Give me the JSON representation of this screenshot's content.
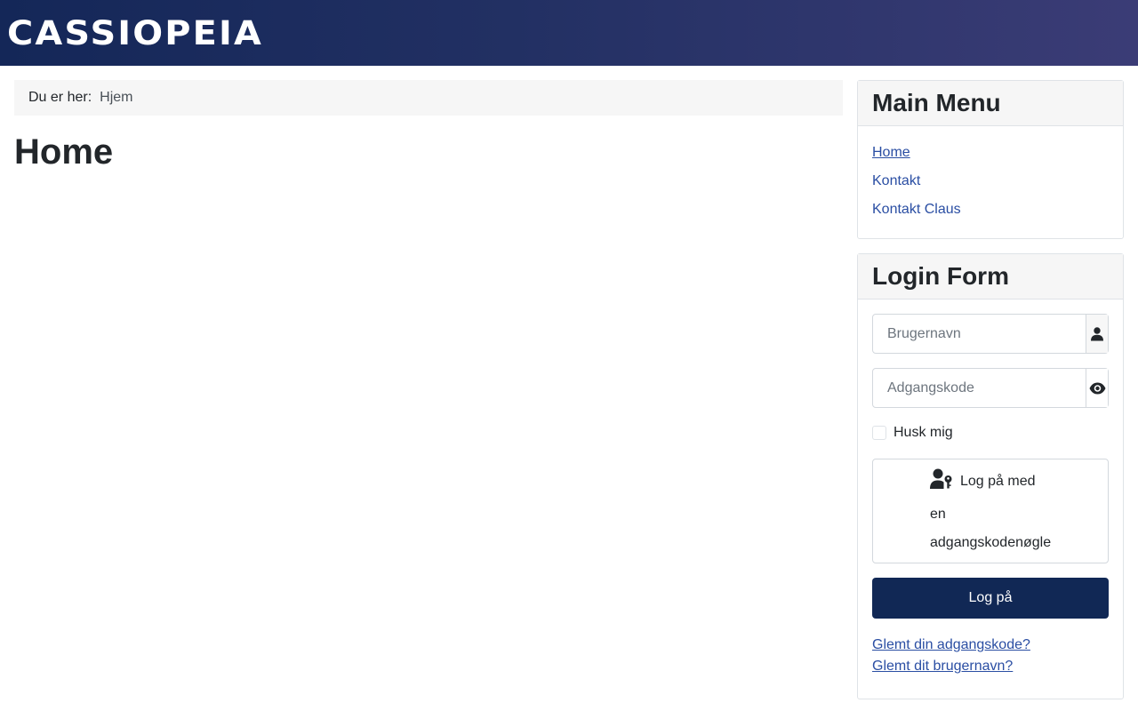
{
  "header": {
    "brand": "CASSIOPEIA",
    "colors": {
      "gradient_start": "#142758",
      "gradient_end": "#3b3c76"
    }
  },
  "breadcrumb": {
    "label": "Du er her:",
    "items": [
      "Hjem"
    ]
  },
  "page": {
    "title": "Home"
  },
  "main_menu": {
    "title": "Main Menu",
    "items": [
      {
        "label": "Home",
        "active": true
      },
      {
        "label": "Kontakt",
        "active": false
      },
      {
        "label": "Kontakt Claus",
        "active": false
      }
    ]
  },
  "login_form": {
    "title": "Login Form",
    "username": {
      "placeholder": "Brugernavn",
      "value": "",
      "icon": "user-icon"
    },
    "password": {
      "placeholder": "Adgangskode",
      "value": "",
      "icon": "eye-icon"
    },
    "remember_label": "Husk mig",
    "passkey_label": "Log på med en adgangskodenøgle",
    "passkey_icon": "user-key-icon",
    "submit_label": "Log på",
    "links": [
      "Glemt din adgangskode?",
      "Glemt dit brugernavn?"
    ],
    "colors": {
      "primary_button": "#112855",
      "link": "#2a4ea3"
    }
  }
}
